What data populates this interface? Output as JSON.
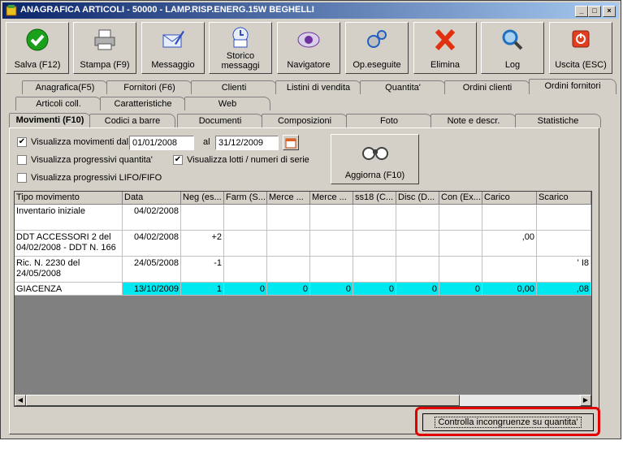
{
  "window": {
    "title": "ANAGRAFICA ARTICOLI - 50000 - LAMP.RISP.ENERG.15W BEGHELLI"
  },
  "toolbar": [
    {
      "label": "Salva (F12)",
      "icon": "check-icon",
      "color": "#1aa01a"
    },
    {
      "label": "Stampa (F9)",
      "icon": "printer-icon",
      "color": "#7a7a7a"
    },
    {
      "label": "Messaggio",
      "icon": "envelope-pen-icon",
      "color": "#3050c0"
    },
    {
      "label": "Storico messaggi",
      "icon": "mail-history-icon",
      "color": "#3050c0"
    },
    {
      "label": "Navigatore",
      "icon": "navigator-icon",
      "color": "#7030a0"
    },
    {
      "label": "Op.eseguite",
      "icon": "gears-icon",
      "color": "#2060c0"
    },
    {
      "label": "Elimina",
      "icon": "delete-x-icon",
      "color": "#e03010"
    },
    {
      "label": "Log",
      "icon": "magnifier-icon",
      "color": "#2070c0"
    },
    {
      "label": "Uscita (ESC)",
      "icon": "exit-icon",
      "color": "#e04020"
    }
  ],
  "tabs_row1": [
    "Anagrafica(F5)",
    "Fornitori (F6)",
    "Clienti",
    "Listini di vendita",
    "Quantita'",
    "Ordini clienti",
    "Ordini fornitori"
  ],
  "tabs_row2": [
    "Articoli coll.",
    "Caratteristiche",
    "Web"
  ],
  "tabs_row3": [
    "Movimenti (F10)",
    "Codici a barre",
    "Documenti",
    "Composizioni",
    "Foto",
    "Note e descr.",
    "Statistiche"
  ],
  "filters": {
    "show_movements_label": "Visualizza movimenti dal",
    "date_from": "01/01/2008",
    "al_label": "al",
    "date_to": "31/12/2009",
    "progressive_qty_label": "Visualizza progressivi quantita'",
    "show_lots_label": "Visualizza lotti / numeri di serie",
    "progressive_lifo_label": "Visualizza progressivi LIFO/FIFO",
    "refresh_label": "Aggiorna (F10)"
  },
  "grid": {
    "columns": [
      "Tipo movimento",
      "Data",
      "Neg (es...",
      "Farm (S...",
      "Merce ...",
      "Merce ...",
      "ss18 (C...",
      "Disc (D...",
      "Con (Ex...",
      "Carico",
      "Scarico"
    ],
    "rows": [
      [
        "Inventario iniziale",
        "04/02/2008",
        "",
        "",
        "",
        "",
        "",
        "",
        "",
        "",
        ""
      ],
      [
        "DDT ACCESSORI 2 del 04/02/2008 - DDT N. 166",
        "04/02/2008",
        "+2",
        "",
        "",
        "",
        "",
        "",
        "",
        ",00",
        ""
      ],
      [
        "Ric. N. 2230 del 24/05/2008",
        "24/05/2008",
        "-1",
        "",
        "",
        "",
        "",
        "",
        "",
        "",
        "' I8"
      ],
      [
        "GIACENZA",
        "13/10/2009",
        "1",
        "0",
        "0",
        "0",
        "0",
        "0",
        "0",
        "0,00",
        ",08"
      ]
    ]
  },
  "footer": {
    "check_button_label": "Controlla incongruenze su quantita'"
  },
  "colors": {
    "highlight_row": "#00e8f0",
    "callout": "#e00000",
    "titlebar": "#0a246a"
  }
}
